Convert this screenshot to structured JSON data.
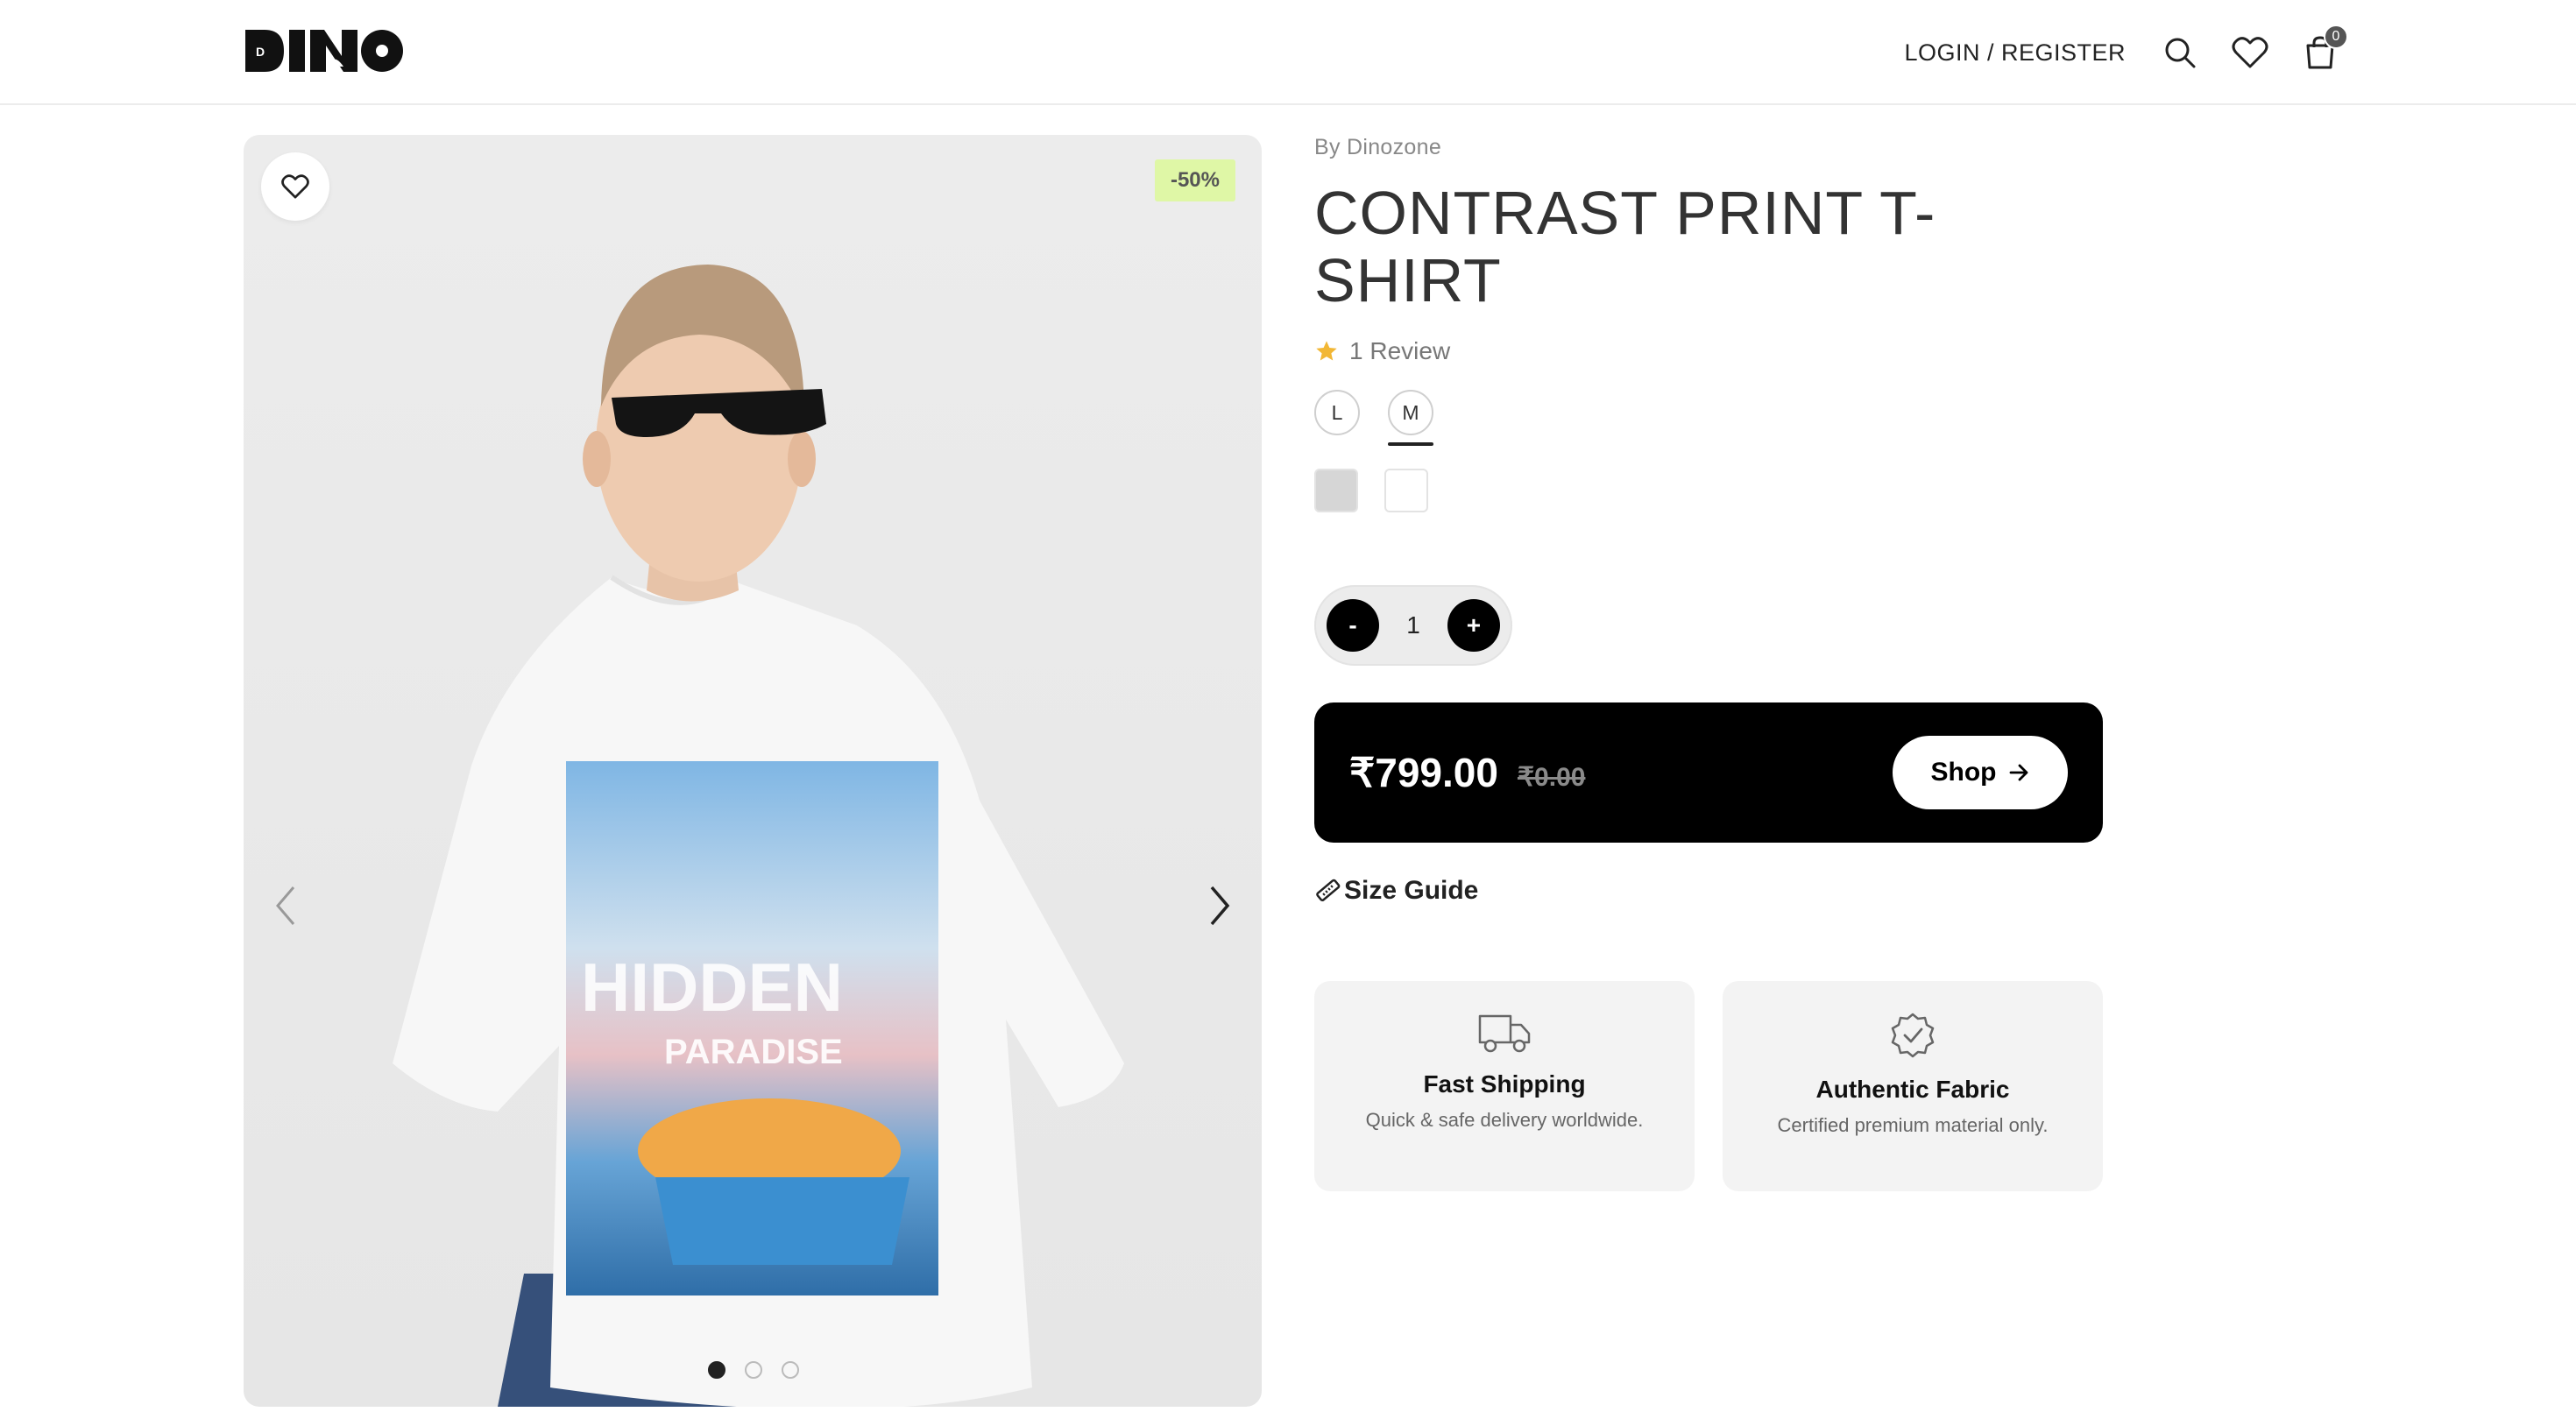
{
  "header": {
    "logo_text": "DINO",
    "login_label": "LOGIN / REGISTER",
    "cart_count": "0"
  },
  "gallery": {
    "discount": "-50%",
    "image_text_line1": "HIDDEN",
    "image_text_line2": "PARADISE",
    "slide_count": 3,
    "active_slide": 1
  },
  "product": {
    "brand": "By Dinozone",
    "title": "CONTRAST PRINT T-SHIRT",
    "rating_count": "1 Review",
    "sizes": [
      "L",
      "M"
    ],
    "selected_size": "M",
    "colors": [
      "#d6d6d6",
      "#ffffff"
    ],
    "quantity": "1",
    "qty_minus": "-",
    "qty_plus": "+",
    "price": "₹799.00",
    "old_price": "₹0.00",
    "shop_label": "Shop",
    "size_guide": "Size Guide"
  },
  "features": [
    {
      "icon": "truck-icon",
      "title": "Fast Shipping",
      "desc": "Quick & safe delivery worldwide."
    },
    {
      "icon": "badge-check-icon",
      "title": "Authentic Fabric",
      "desc": "Certified premium material only."
    }
  ],
  "colors": {
    "accent": "#000000",
    "badge_bg": "#dff7a6",
    "star": "#f2b735"
  }
}
